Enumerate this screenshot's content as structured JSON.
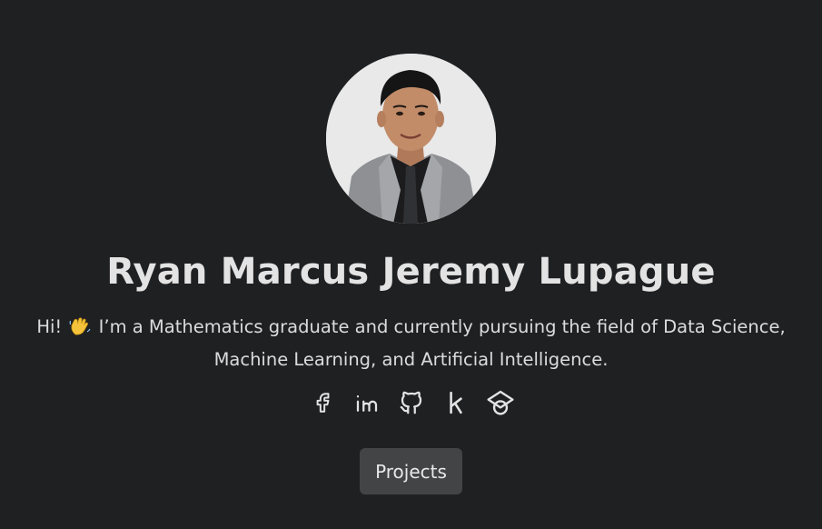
{
  "profile": {
    "name": "Ryan Marcus Jeremy Lupague",
    "avatar_alt": "Profile photo of Ryan Marcus Jeremy Lupague"
  },
  "bio": {
    "greeting": "Hi!",
    "wave_icon": "waving-hand-emoji",
    "line1_rest": "I’m a Mathematics graduate and currently pursuing the field of Data Science,",
    "line2": "Machine Learning, and Artificial Intelligence."
  },
  "socials": [
    {
      "icon": "facebook-icon"
    },
    {
      "icon": "linkedin-icon"
    },
    {
      "icon": "github-icon"
    },
    {
      "icon": "kaggle-icon"
    },
    {
      "icon": "graduation-cap-icon"
    }
  ],
  "actions": {
    "projects_label": "Projects"
  },
  "colors": {
    "background": "#1f2022",
    "text": "#e3e3e3",
    "button_bg": "#434446",
    "avatar_bg": "#e9e9e9"
  }
}
